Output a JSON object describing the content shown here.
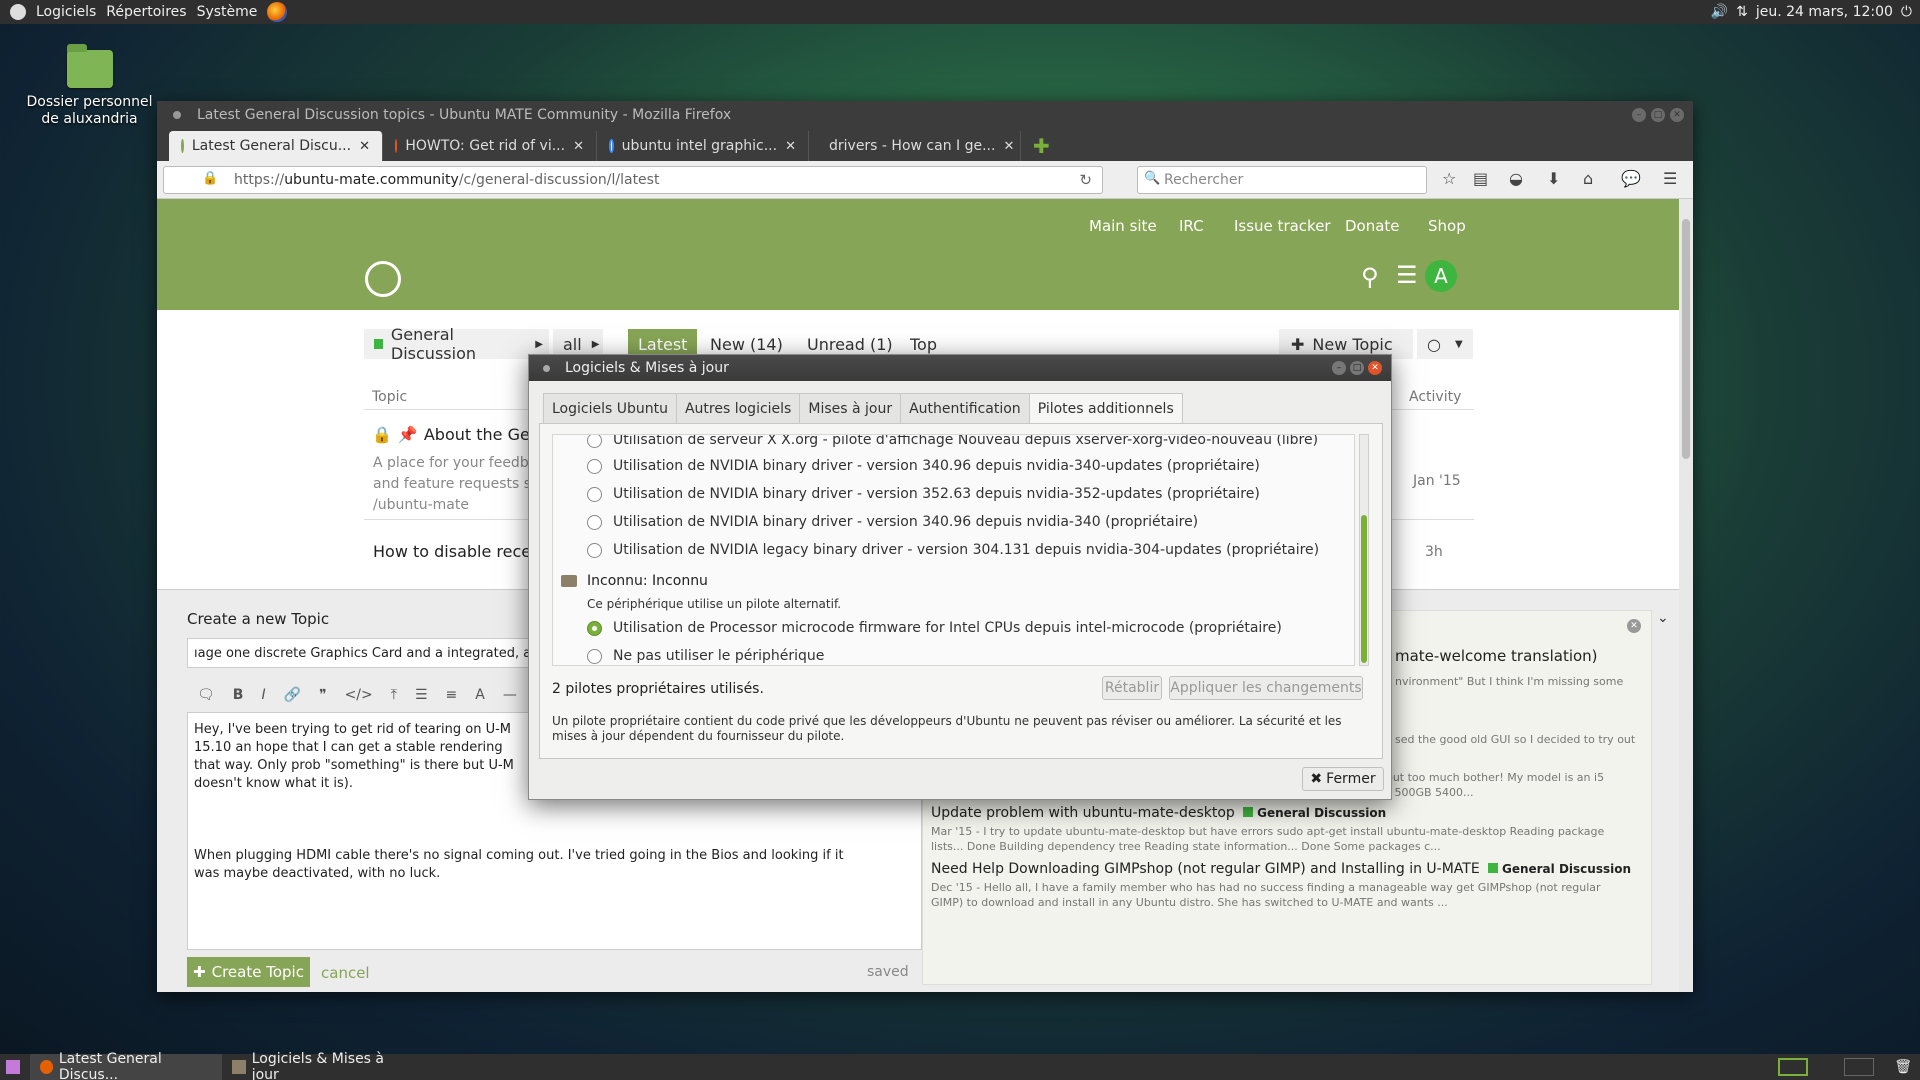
{
  "top_panel": {
    "menu_apps": "Logiciels",
    "menu_places": "Répertoires",
    "menu_system": "Système",
    "clock": "jeu. 24 mars, 12:00"
  },
  "desktop": {
    "home_folder_label": "Dossier personnel de aluxandria"
  },
  "firefox": {
    "window_title": "Latest General Discussion topics - Ubuntu MATE Community - Mozilla Firefox",
    "tabs": [
      {
        "label": "Latest General Discu..."
      },
      {
        "label": "HOWTO: Get rid of vi..."
      },
      {
        "label": "ubuntu intel graphic..."
      },
      {
        "label": "drivers - How can I ge..."
      }
    ],
    "url_scheme": "https://",
    "url_host": "ubuntu-mate.community",
    "url_path": "/c/general-discussion/l/latest",
    "search_placeholder": "Rechercher"
  },
  "site": {
    "header_links": [
      "Main site",
      "IRC",
      "Issue tracker",
      "Donate",
      "Shop"
    ],
    "avatar_letter": "A",
    "category": "General Discussion",
    "filter_all": "all",
    "nav_latest": "Latest",
    "nav_new": "New (14)",
    "nav_unread": "Unread (1)",
    "nav_top": "Top",
    "new_topic": "New Topic",
    "col_topic": "Topic",
    "col_activity": "Activity",
    "topic1_title": "About the Gener",
    "topic1_excerpt_1": "A place for your feedba",
    "topic1_excerpt_2": "and feature requests s",
    "topic1_excerpt_3": "/ubuntu-mate",
    "topic1_activity": "Jan '15",
    "topic2_title": "How to disable recent",
    "topic2_activity": "3h"
  },
  "compose": {
    "heading": "Create a new Topic",
    "title_value": "ıage one discrete Graphics Card and a integrated, at the s",
    "body_p1": "Hey, I've been trying to get rid of tearing on U-M 15.10 an hope that I can get a stable rendering that way. Only prob \"something\" is there but U-M doesn't know what it is).",
    "body_p2": "When plugging HDMI cable there's no signal coming out. I've tried going in the Bios and looking if it was maybe deactivated, with no luck.",
    "create_button": "Create Topic",
    "cancel": "cancel",
    "saved": "saved",
    "similar": [
      {
        "title": "mate-welcome translation)",
        "cat": "",
        "excerpt": ""
      },
      {
        "title": "",
        "cat": "",
        "excerpt": "nvironment\" But I think I'm missing some"
      },
      {
        "title": "",
        "cat": "",
        "excerpt": "sed the good old GUI so I decided to try out"
      },
      {
        "title": "",
        "cat": "",
        "excerpt": "Jan '15 - I've managed to get Ubuntu MATE 14.04 running on a 2011 Mac Mini without too much bother! My model is an i5 (2.5Ghz) with discreet AMD Radeon Graphics (6630m), stock 4GB of RAM and stock 500GB 5400..."
      },
      {
        "title": "Update problem with ubuntu-mate-desktop",
        "cat": "General Discussion",
        "excerpt": "Mar '15 - I try to update ubuntu-mate-desktop but have errors sudo apt-get install ubuntu-mate-desktop Reading package lists... Done Building dependency tree Reading state information... Done Some packages c..."
      },
      {
        "title": "Need Help Downloading GIMPshop (not regular GIMP) and Installing in U-MATE",
        "cat": "General Discussion",
        "excerpt": "Dec '15 - Hello all, I have a family member who has had no success finding a manageable way get GIMPshop (not regular GIMP) to download and install in any Ubuntu distro. She has switched to U-MATE and wants ..."
      }
    ]
  },
  "dialog": {
    "title": "Logiciels & Mises à jour",
    "tabs": [
      "Logiciels Ubuntu",
      "Autres logiciels",
      "Mises à jour",
      "Authentification",
      "Pilotes additionnels"
    ],
    "drivers": [
      {
        "label": "Utilisation de serveur X X.org - pilote d'affichage Nouveau depuis xserver-xorg-video-nouveau (libre)",
        "selected": false
      },
      {
        "label": "Utilisation de NVIDIA binary driver - version 340.96 depuis nvidia-340-updates (propriétaire)",
        "selected": false
      },
      {
        "label": "Utilisation de NVIDIA binary driver - version 352.63 depuis nvidia-352-updates (propriétaire)",
        "selected": false
      },
      {
        "label": "Utilisation de NVIDIA binary driver - version 340.96 depuis nvidia-340 (propriétaire)",
        "selected": false
      },
      {
        "label": "Utilisation de NVIDIA legacy binary driver - version 304.131 depuis nvidia-304-updates (propriétaire)",
        "selected": false
      }
    ],
    "device_name": "Inconnu: Inconnu",
    "device_note": "Ce périphérique utilise un pilote alternatif.",
    "device_drivers": [
      {
        "label": "Utilisation de Processor microcode firmware for Intel CPUs depuis intel-microcode (propriétaire)",
        "selected": true
      },
      {
        "label": "Ne pas utiliser le périphérique",
        "selected": false
      }
    ],
    "status": "2 pilotes propriétaires utilisés.",
    "revert_button": "Rétablir",
    "apply_button": "Appliquer les changements",
    "info_text": "Un pilote propriétaire contient du code privé que les développeurs d'Ubuntu ne peuvent pas réviser ou améliorer. La sécurité et les mises à jour dépendent du fournisseur du pilote.",
    "close_button": "Fermer"
  },
  "taskbar": {
    "items": [
      "Latest General Discus...",
      "Logiciels & Mises à jour"
    ]
  },
  "colors": {
    "site_green": "#87a556",
    "accent_green": "#7ab039"
  }
}
